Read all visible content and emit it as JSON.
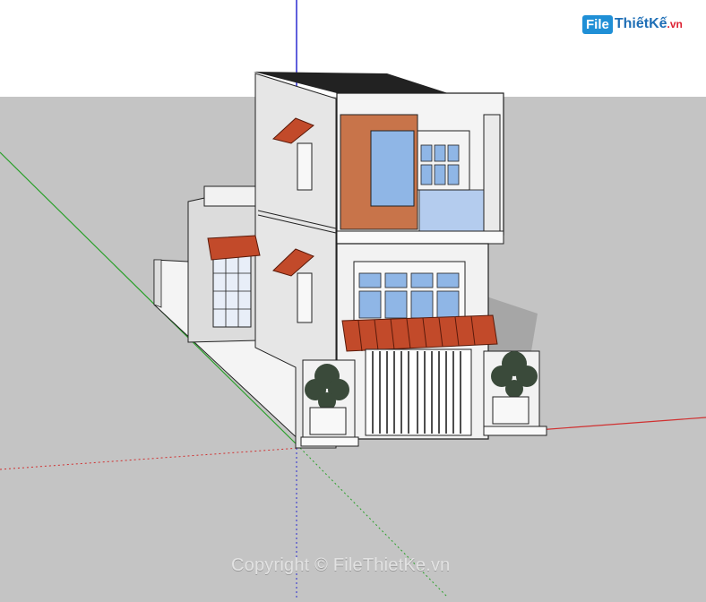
{
  "logo": {
    "badge": "File",
    "name": "ThiếtKế",
    "tld": ".vn"
  },
  "watermark": {
    "text": "Copyright © FileThietKe.vn"
  },
  "colors": {
    "sky": "#ffffff",
    "ground": "#c4c4c4",
    "axis_red": "#d03030",
    "axis_green": "#2aa02a",
    "axis_blue": "#2a2ad0",
    "brick": "#c8744a",
    "roof_tile": "#c24a2a",
    "glass": "#8fb6e6",
    "wall": "#f2f2f2",
    "wall_shade": "#dadada",
    "plant": "#3a4a3a"
  },
  "scene": {
    "model": "two-storey townhouse",
    "icons": [
      "red-axis",
      "green-axis",
      "blue-axis"
    ]
  }
}
